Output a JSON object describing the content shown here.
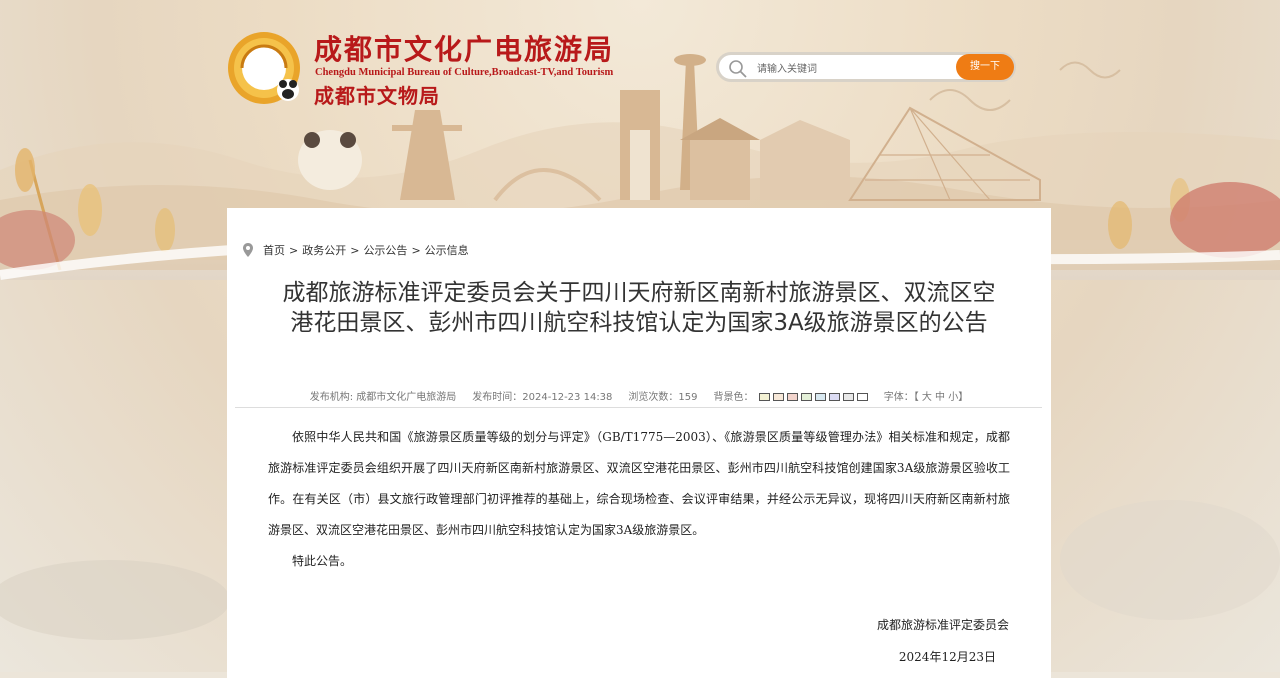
{
  "header": {
    "title_cn": "成都市文化广电旅游局",
    "title_en": "Chengdu Municipal Bureau of Culture,Broadcast-TV,and Tourism",
    "title_cn_sub": "成都市文物局"
  },
  "search": {
    "placeholder": "请输入关键词",
    "button_label": "搜一下"
  },
  "breadcrumb": {
    "items": [
      "首页",
      "政务公开",
      "公示公告",
      "公示信息"
    ],
    "separator": ">"
  },
  "article": {
    "title": "成都旅游标准评定委员会关于四川天府新区南新村旅游景区、双流区空港花田景区、彭州市四川航空科技馆认定为国家3A级旅游景区的公告",
    "meta": {
      "publisher": "发布机构: 成都市文化广电旅游局",
      "time": "发布时间：2024-12-23 14:38",
      "views": "浏览次数：159",
      "bg_label": "背景色：",
      "font_label": "字体：【 大 中 小】"
    },
    "bg_colors": [
      "#f4f2d4",
      "#f7e8d8",
      "#f2d4cc",
      "#e4f0d8",
      "#d8e8f0",
      "#dcdcf4",
      "#e8e8e8",
      "#ffffff"
    ],
    "paragraphs": [
      "依照中华人民共和国《旅游景区质量等级的划分与评定》（GB/T1775—2003）、《旅游景区质量等级管理办法》相关标准和规定，成都旅游标准评定委员会组织开展了四川天府新区南新村旅游景区、双流区空港花田景区、彭州市四川航空科技馆创建国家3A级旅游景区验收工作。在有关区（市）县文旅行政管理部门初评推荐的基础上，综合现场检查、会议评审结果，并经公示无异议，现将四川天府新区南新村旅游景区、双流区空港花田景区、彭州市四川航空科技馆认定为国家3A级旅游景区。",
      "特此公告。"
    ],
    "signature": "成都旅游标准评定委员会",
    "date": "2024年12月23日"
  },
  "colors": {
    "brand_red": "#b8191a",
    "accent_orange": "#ef7c14"
  }
}
